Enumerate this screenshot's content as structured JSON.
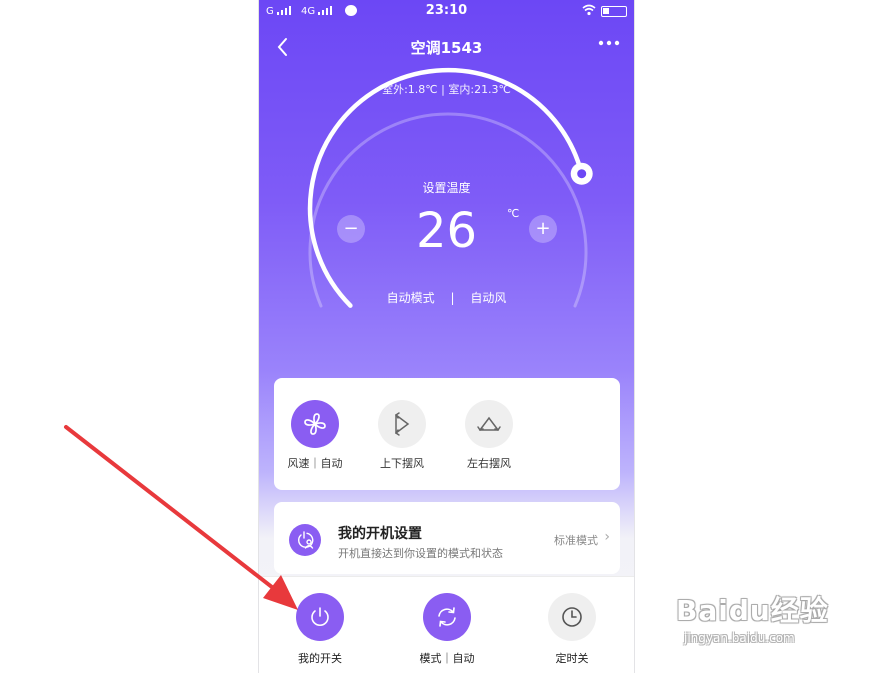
{
  "status_bar": {
    "carrier1": "G",
    "carrier2": "4G",
    "time": "23:10"
  },
  "header": {
    "title": "空调1543",
    "back_icon": "chevron-left-icon",
    "more_icon": "more-dots-icon"
  },
  "environment": {
    "outdoor": "室外:1.8℃",
    "separator": "|",
    "indoor": "室内:21.3℃"
  },
  "dial": {
    "label": "设置温度",
    "temperature": "26",
    "unit": "℃",
    "minus": "−",
    "plus": "+",
    "mode": "自动模式",
    "separator": "|",
    "wind": "自动风",
    "level": 0.78
  },
  "wind_controls": [
    {
      "label": "风速｜自动",
      "icon": "fan-icon",
      "active": true
    },
    {
      "label": "上下摆风",
      "icon": "vertical-swing-icon",
      "active": false
    },
    {
      "label": "左右摆风",
      "icon": "horizontal-swing-icon",
      "active": false
    }
  ],
  "boot_setting": {
    "title": "我的开机设置",
    "description": "开机直接达到你设置的模式和状态",
    "value": "标准模式",
    "arrow": "›"
  },
  "bottom_tabs": [
    {
      "label": "我的开关",
      "icon": "power-icon"
    },
    {
      "label": "模式｜自动",
      "icon": "cycle-mode-icon"
    },
    {
      "label": "定时关",
      "icon": "clock-icon"
    }
  ],
  "watermark": {
    "main": "Baidu经验",
    "sub": "jingyan.baidu.com"
  },
  "colors": {
    "accent": "#8a5df2",
    "header_gradient_top": "#6c47f5",
    "annotation_arrow": "#e8393c"
  }
}
